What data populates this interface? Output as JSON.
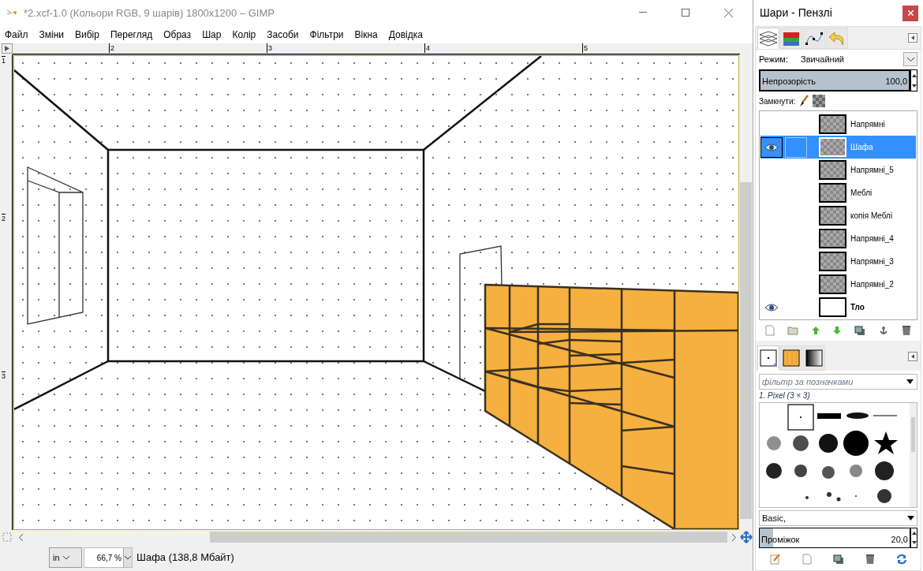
{
  "window": {
    "title": "*2.xcf-1.0 (Кольори RGB, 9 шарів) 1800x1200 – GIMP"
  },
  "menu": [
    "Файл",
    "Зміни",
    "Вибір",
    "Перегляд",
    "Образ",
    "Шар",
    "Колір",
    "Засоби",
    "Фільтри",
    "Вікна",
    "Довідка"
  ],
  "rulers": {
    "horizontal_labels": [
      "2",
      "3",
      "4",
      "5"
    ],
    "vertical_labels": [
      "1",
      "2",
      "3"
    ]
  },
  "status_bar": {
    "unit": "in",
    "zoom": "66,7 %",
    "info": "Шафа (138,8 Мбайт)"
  },
  "dock": {
    "title": "Шари - Пензлі",
    "tabs": [
      {
        "kind": "layers",
        "selected": true
      },
      {
        "kind": "channels",
        "selected": false
      },
      {
        "kind": "paths",
        "selected": false
      },
      {
        "kind": "undo",
        "selected": false
      }
    ],
    "mode_label": "Режим:",
    "mode_value": "Звичайний",
    "opacity": {
      "label": "Непрозорість",
      "value": "100,0",
      "level": 1.0
    },
    "lock_label": "Замкнути:",
    "layers": [
      {
        "name": "Напрямні",
        "visible": false,
        "selected": false,
        "has_alpha": true
      },
      {
        "name": "Шафа",
        "visible": true,
        "selected": true,
        "has_alpha": true
      },
      {
        "name": "Напрямні_5",
        "visible": false,
        "selected": false,
        "has_alpha": true
      },
      {
        "name": "Меблі",
        "visible": false,
        "selected": false,
        "has_alpha": true
      },
      {
        "name": "копія Меблі",
        "visible": false,
        "selected": false,
        "has_alpha": true
      },
      {
        "name": "Напрямні_4",
        "visible": false,
        "selected": false,
        "has_alpha": true
      },
      {
        "name": "Напрямні_3",
        "visible": false,
        "selected": false,
        "has_alpha": true
      },
      {
        "name": "Напрямні_2",
        "visible": false,
        "selected": false,
        "has_alpha": true
      },
      {
        "name": "Тло",
        "visible": true,
        "selected": false,
        "has_alpha": false
      }
    ],
    "brush_tabs": [
      {
        "kind": "brush",
        "selected": true
      },
      {
        "kind": "pattern",
        "selected": false
      },
      {
        "kind": "gradient",
        "selected": false
      }
    ],
    "filter": {
      "placeholder": "фільтр за позначками"
    },
    "brush_name": "1. Pixel (3 × 3)",
    "preset": "Basic,",
    "spacing": {
      "label": "Проміжок",
      "value": "20,0",
      "level": 0.09
    }
  }
}
